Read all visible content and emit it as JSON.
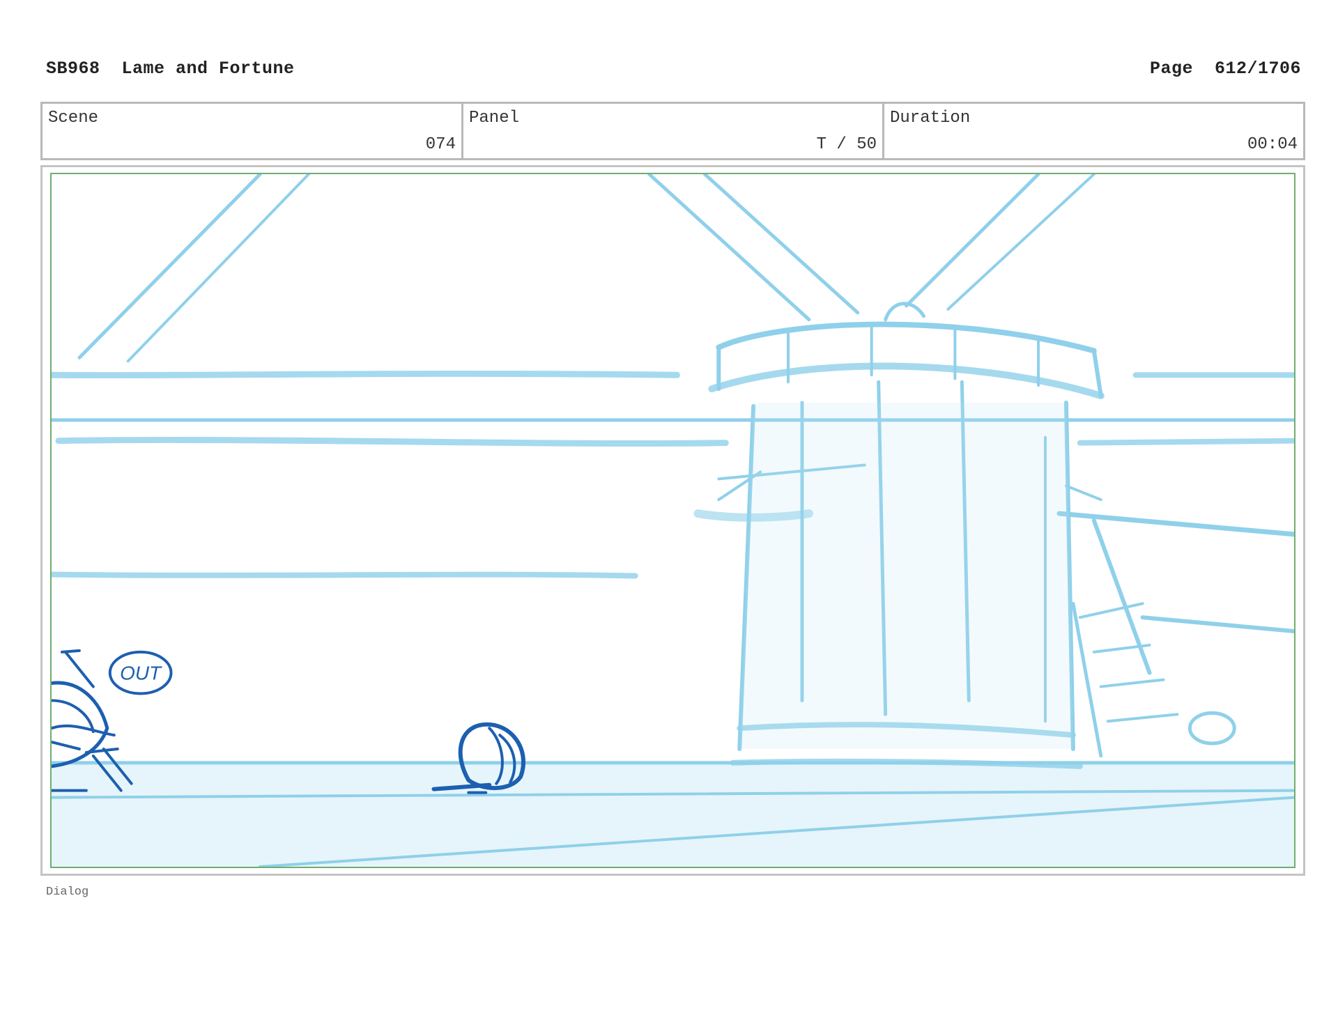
{
  "header": {
    "title": "SB968  Lame and Fortune",
    "page_label": "Page  612/1706"
  },
  "info": {
    "scene_label": "Scene",
    "scene_value": "074",
    "panel_label": "Panel",
    "panel_value": "T / 50",
    "duration_label": "Duration",
    "duration_value": "00:04"
  },
  "panel": {
    "sketch_text": "OUT"
  },
  "footer": {
    "dialog_label": "Dialog"
  },
  "colors": {
    "background_sketch": "#8fd0ea",
    "character_sketch": "#1d5fb0",
    "panel_border": "#6fae6f"
  }
}
